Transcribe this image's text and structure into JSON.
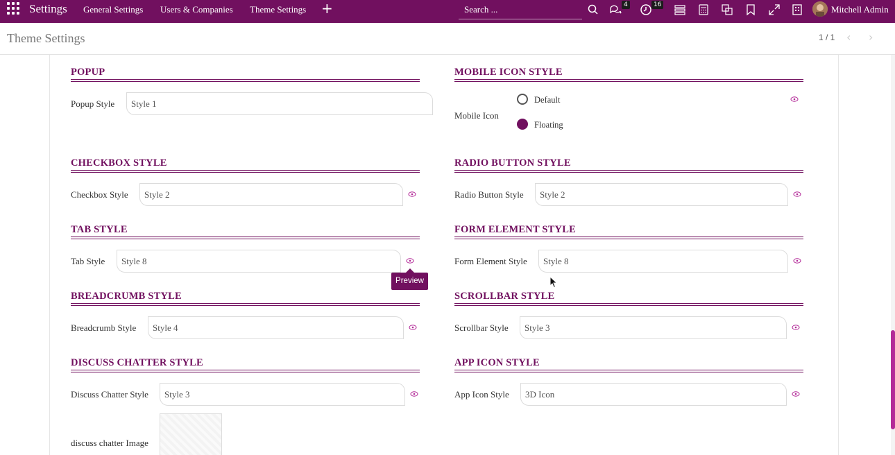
{
  "navbar": {
    "brand": "Settings",
    "menu": [
      "General Settings",
      "Users & Companies",
      "Theme Settings"
    ],
    "search_placeholder": "Search ...",
    "messages_badge": "4",
    "activities_badge": "16",
    "user_name": "Mitchell Admin",
    "icons": [
      "apps-icon",
      "plus-icon",
      "search-icon",
      "chat-icon",
      "clock-icon",
      "layout-icon",
      "calculator-icon",
      "language-icon",
      "bookmark-icon",
      "fullscreen-icon",
      "building-icon"
    ]
  },
  "control_panel": {
    "title": "Theme Settings",
    "pager": "1 / 1"
  },
  "sections": {
    "popup": {
      "title": "POPUP",
      "label": "Popup Style",
      "value": "Style 1"
    },
    "mobile_icon": {
      "title": "MOBILE ICON STYLE",
      "label": "Mobile Icon",
      "options": [
        "Default",
        "Floating"
      ],
      "selected": "Floating"
    },
    "checkbox": {
      "title": "CHECKBOX STYLE",
      "label": "Checkbox Style",
      "value": "Style 2"
    },
    "radio_button": {
      "title": "RADIO BUTTON STYLE",
      "label": "Radio Button Style",
      "value": "Style 2"
    },
    "tab": {
      "title": "TAB STYLE",
      "label": "Tab Style",
      "value": "Style 8"
    },
    "form_element": {
      "title": "FORM ELEMENT STYLE",
      "label": "Form Element Style",
      "value": "Style 8"
    },
    "breadcrumb": {
      "title": "BREADCRUMB STYLE",
      "label": "Breadcrumb Style",
      "value": "Style 4"
    },
    "scrollbar": {
      "title": "SCROLLBAR STYLE",
      "label": "Scrollbar Style",
      "value": "Style 3"
    },
    "discuss_chatter": {
      "title": "DISCUSS CHATTER STYLE",
      "label": "Discuss Chatter Style",
      "value": "Style 3",
      "image_label": "discuss chatter Image"
    },
    "app_icon": {
      "title": "APP ICON STYLE",
      "label": "App Icon Style",
      "value": "3D Icon"
    }
  },
  "tooltip": {
    "text": "Preview"
  },
  "colors": {
    "brand": "#71105f",
    "scrollbar": "#b32a98"
  }
}
